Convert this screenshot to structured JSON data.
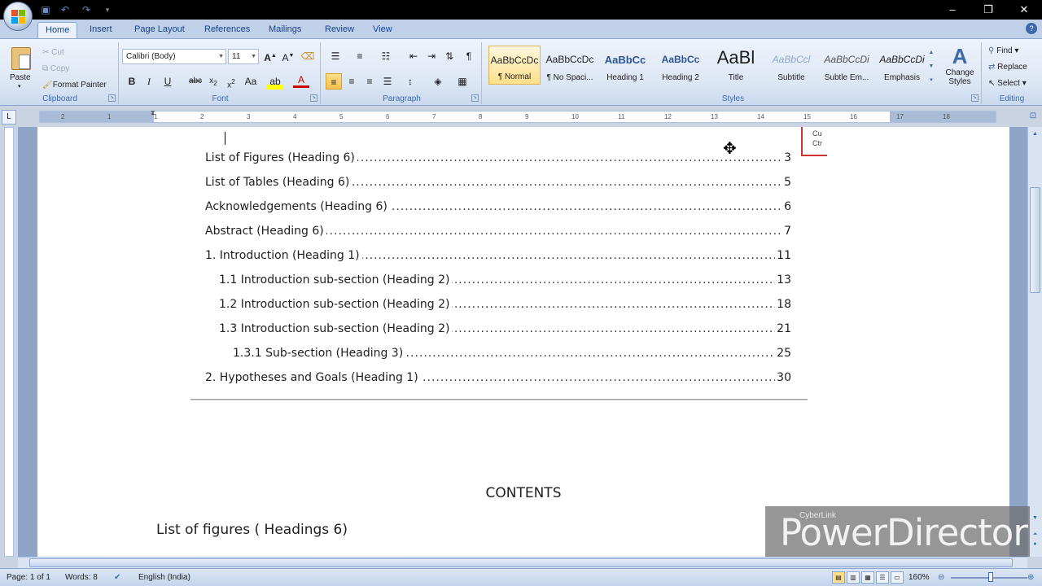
{
  "tabs": [
    "Home",
    "Insert",
    "Page Layout",
    "References",
    "Mailings",
    "Review",
    "View"
  ],
  "active_tab": "Home",
  "clipboard": {
    "paste_label": "Paste",
    "cut_label": "Cut",
    "copy_label": "Copy",
    "format_painter_label": "Format Painter",
    "group_label": "Clipboard"
  },
  "font": {
    "name": "Calibri (Body)",
    "size": "11",
    "group_label": "Font"
  },
  "paragraph": {
    "group_label": "Paragraph"
  },
  "styles": {
    "group_label": "Styles",
    "tiles": [
      {
        "sample": "AaBbCcDc",
        "name": "¶ Normal"
      },
      {
        "sample": "AaBbCcDc",
        "name": "¶ No Spaci..."
      },
      {
        "sample": "AaBbCc",
        "name": "Heading 1"
      },
      {
        "sample": "AaBbCc",
        "name": "Heading 2"
      },
      {
        "sample": "AaBl",
        "name": "Title"
      },
      {
        "sample": "AaBbCcl",
        "name": "Subtitle"
      },
      {
        "sample": "AaBbCcDi",
        "name": "Subtle Em..."
      },
      {
        "sample": "AaBbCcDi",
        "name": "Emphasis"
      }
    ],
    "change_styles_label": "Change Styles"
  },
  "editing": {
    "find_label": "Find",
    "replace_label": "Replace",
    "select_label": "Select",
    "group_label": "Editing"
  },
  "ruler_numbers": [
    "2",
    "1",
    "1",
    "2",
    "3",
    "4",
    "5",
    "6",
    "7",
    "8",
    "9",
    "10",
    "11",
    "12",
    "13",
    "14",
    "15",
    "16",
    "17",
    "18"
  ],
  "document": {
    "toc": [
      {
        "text": "List of Figures (Heading 6)",
        "page": "3",
        "indent": 0
      },
      {
        "text": "List of Tables (Heading 6)",
        "page": "5",
        "indent": 0
      },
      {
        "text": "Acknowledgements (Heading 6)",
        "page": "6",
        "indent": 0
      },
      {
        "text": "Abstract (Heading 6)",
        "page": "7",
        "indent": 0
      },
      {
        "text": "1. Introduction (Heading 1)",
        "page": "11",
        "indent": 0
      },
      {
        "text": "1.1 Introduction sub-section (Heading 2)",
        "page": "13",
        "indent": 1
      },
      {
        "text": "1.2 Introduction sub-section (Heading 2)",
        "page": "18",
        "indent": 1
      },
      {
        "text": "1.3 Introduction sub-section (Heading 2)",
        "page": "21",
        "indent": 1
      },
      {
        "text": "1.3.1 Sub-section (Heading 3)",
        "page": "25",
        "indent": 2
      },
      {
        "text": "2. Hypotheses and Goals (Heading 1)",
        "page": "30",
        "indent": 0
      }
    ],
    "tooltip_lines": [
      "Cu",
      "Ctr"
    ],
    "contents_heading": "CONTENTS",
    "lof_heading": "List of figures ( Headings 6)"
  },
  "status": {
    "page": "Page: 1 of 1",
    "words": "Words: 8",
    "language": "English (India)",
    "zoom": "160%"
  },
  "watermark": {
    "small": "CyberLink",
    "big": "PowerDirector"
  },
  "colors": {
    "ribbon_text": "#15428b",
    "accent_red": "#cc3333"
  }
}
